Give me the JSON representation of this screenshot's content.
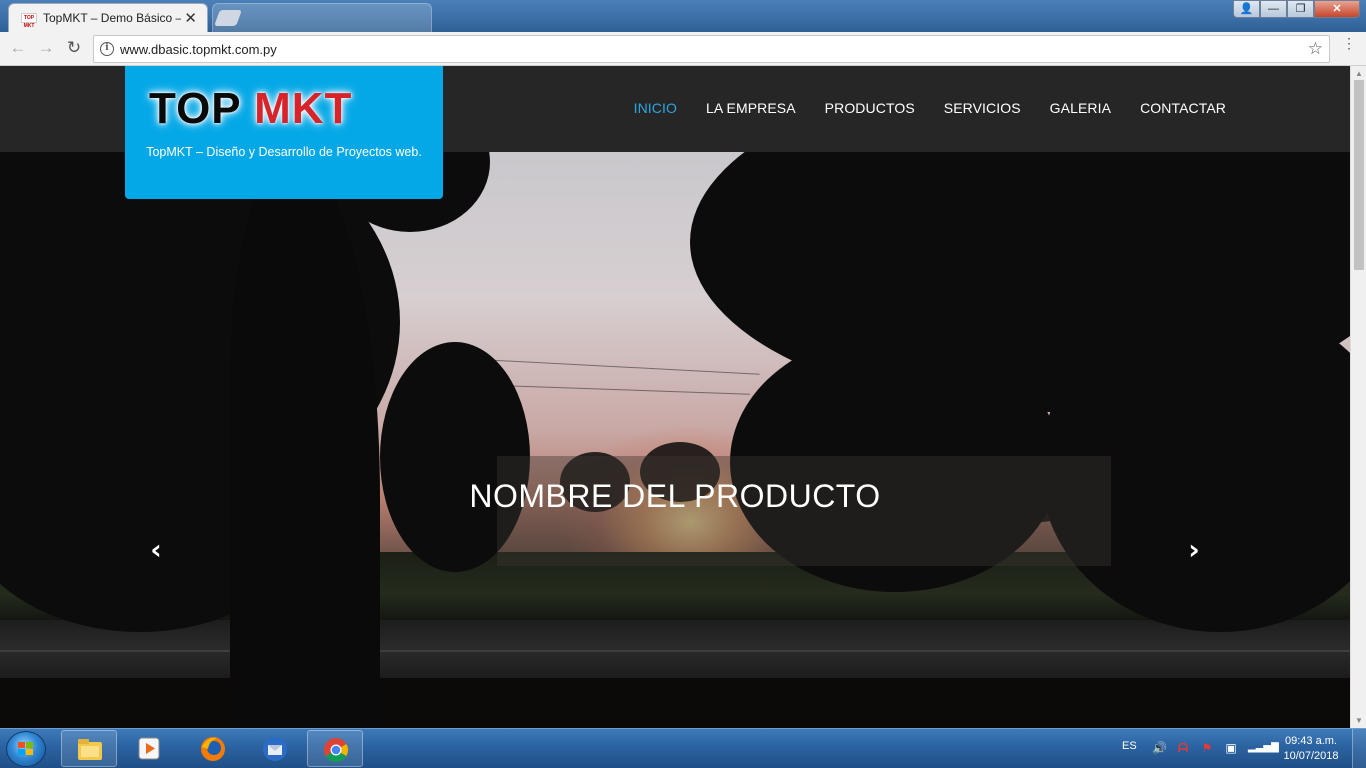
{
  "browser": {
    "tabs": [
      {
        "title": "TopMKT – Demo Básico –",
        "favicon": "topmkt-favicon",
        "active": true
      },
      {
        "title": "",
        "active": false
      }
    ],
    "favicon_text": "TOP MKT",
    "close_tab_glyph": "✕",
    "window_buttons": {
      "user": "👤",
      "minimize": "—",
      "maximize": "❐",
      "close": "✕"
    },
    "nav": {
      "back": "←",
      "forward": "→",
      "reload": "↻"
    },
    "address": {
      "url": "www.dbasic.topmkt.com.py",
      "info_glyph": "i"
    },
    "bookmark_glyph": "☆",
    "menu_glyph": "⋮"
  },
  "site": {
    "logo": {
      "part1": "TOP ",
      "part2": "MKT"
    },
    "tagline": "TopMKT – Diseño y Desarrollo de Proyectos web.",
    "nav": [
      {
        "label": "INICIO",
        "active": true
      },
      {
        "label": "LA EMPRESA",
        "active": false
      },
      {
        "label": "PRODUCTOS",
        "active": false
      },
      {
        "label": "SERVICIOS",
        "active": false
      },
      {
        "label": "GALERIA",
        "active": false
      },
      {
        "label": "CONTACTAR",
        "active": false
      }
    ],
    "hero": {
      "caption": "NOMBRE DEL PRODUCTO",
      "prev_glyph": "‹",
      "next_glyph": "›"
    },
    "colors": {
      "brand_blue": "#05a8e7",
      "nav_active": "#2aa7e0",
      "header_bg": "#262626",
      "logo_red": "#d9232b"
    }
  },
  "taskbar": {
    "apps": [
      {
        "name": "file-explorer",
        "pinned": true
      },
      {
        "name": "media-player",
        "pinned": false
      },
      {
        "name": "firefox",
        "pinned": false
      },
      {
        "name": "thunderbird",
        "pinned": false
      },
      {
        "name": "chrome",
        "pinned": true,
        "running": true
      }
    ],
    "tray": {
      "language": "ES",
      "icons": [
        "volume-icon",
        "antivirus-icon",
        "action-center-flag-icon",
        "network-alert-icon",
        "signal-icon"
      ]
    },
    "clock": {
      "time": "09:43 a.m.",
      "date": "10/07/2018"
    }
  }
}
